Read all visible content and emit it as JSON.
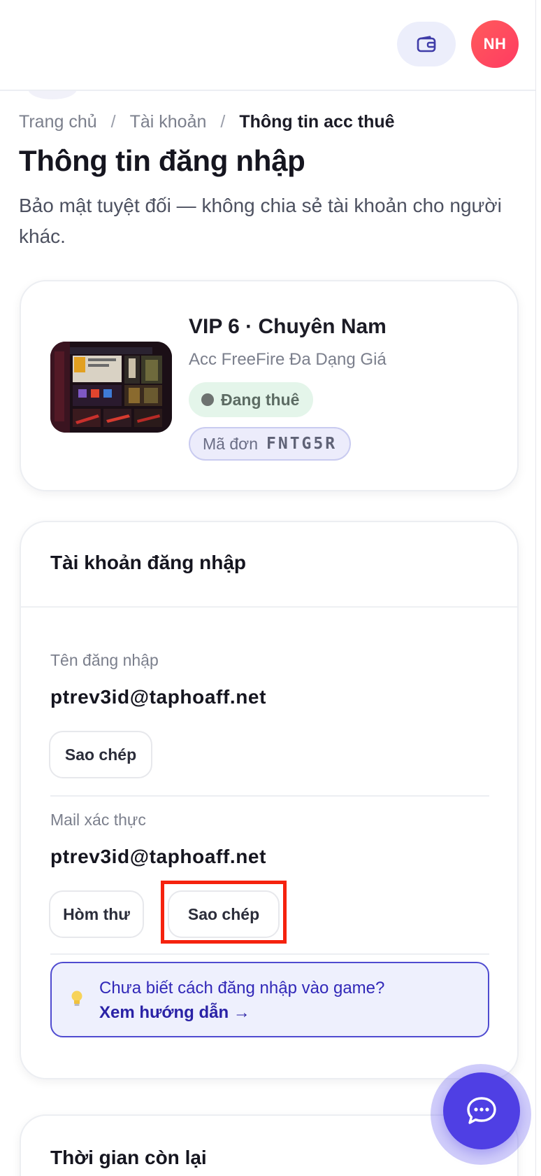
{
  "header": {
    "wallet_icon": "wallet-icon",
    "avatar_initials": "NH",
    "avatar_color": "#ff4b5e"
  },
  "breadcrumb": {
    "items": [
      "Trang chủ",
      "Tài khoản"
    ],
    "separator": "/",
    "current": "Thông tin acc thuê"
  },
  "page": {
    "title": "Thông tin đăng nhập",
    "subtitle": "Bảo mật tuyệt đối — không chia sẻ tài khoản cho người khác."
  },
  "product": {
    "title": "VIP 6 · Chuyên Nam",
    "category": "Acc FreeFire Đa Dạng Giá",
    "status": "Đang thuê",
    "order_label": "Mã đơn",
    "order_code": "FNTG5R"
  },
  "login": {
    "section_title": "Tài khoản đăng nhập",
    "username_label": "Tên đăng nhập",
    "username_value": "ptrev3id@taphoaff.net",
    "username_copy": "Sao chép",
    "mail_label": "Mail xác thực",
    "mail_value": "ptrev3id@taphoaff.net",
    "mail_inbox": "Hòm thư",
    "mail_copy": "Sao chép",
    "hint_text": "Chưa biết cách đăng nhập vào game?",
    "hint_link": "Xem hướng dẫn →",
    "hint_icon": "lightbulb-icon"
  },
  "time": {
    "section_title": "Thời gian còn lại"
  },
  "chat": {
    "icon": "chat-bubble-icon",
    "color": "#4f3fe4"
  },
  "accent": "#4f4bd0"
}
